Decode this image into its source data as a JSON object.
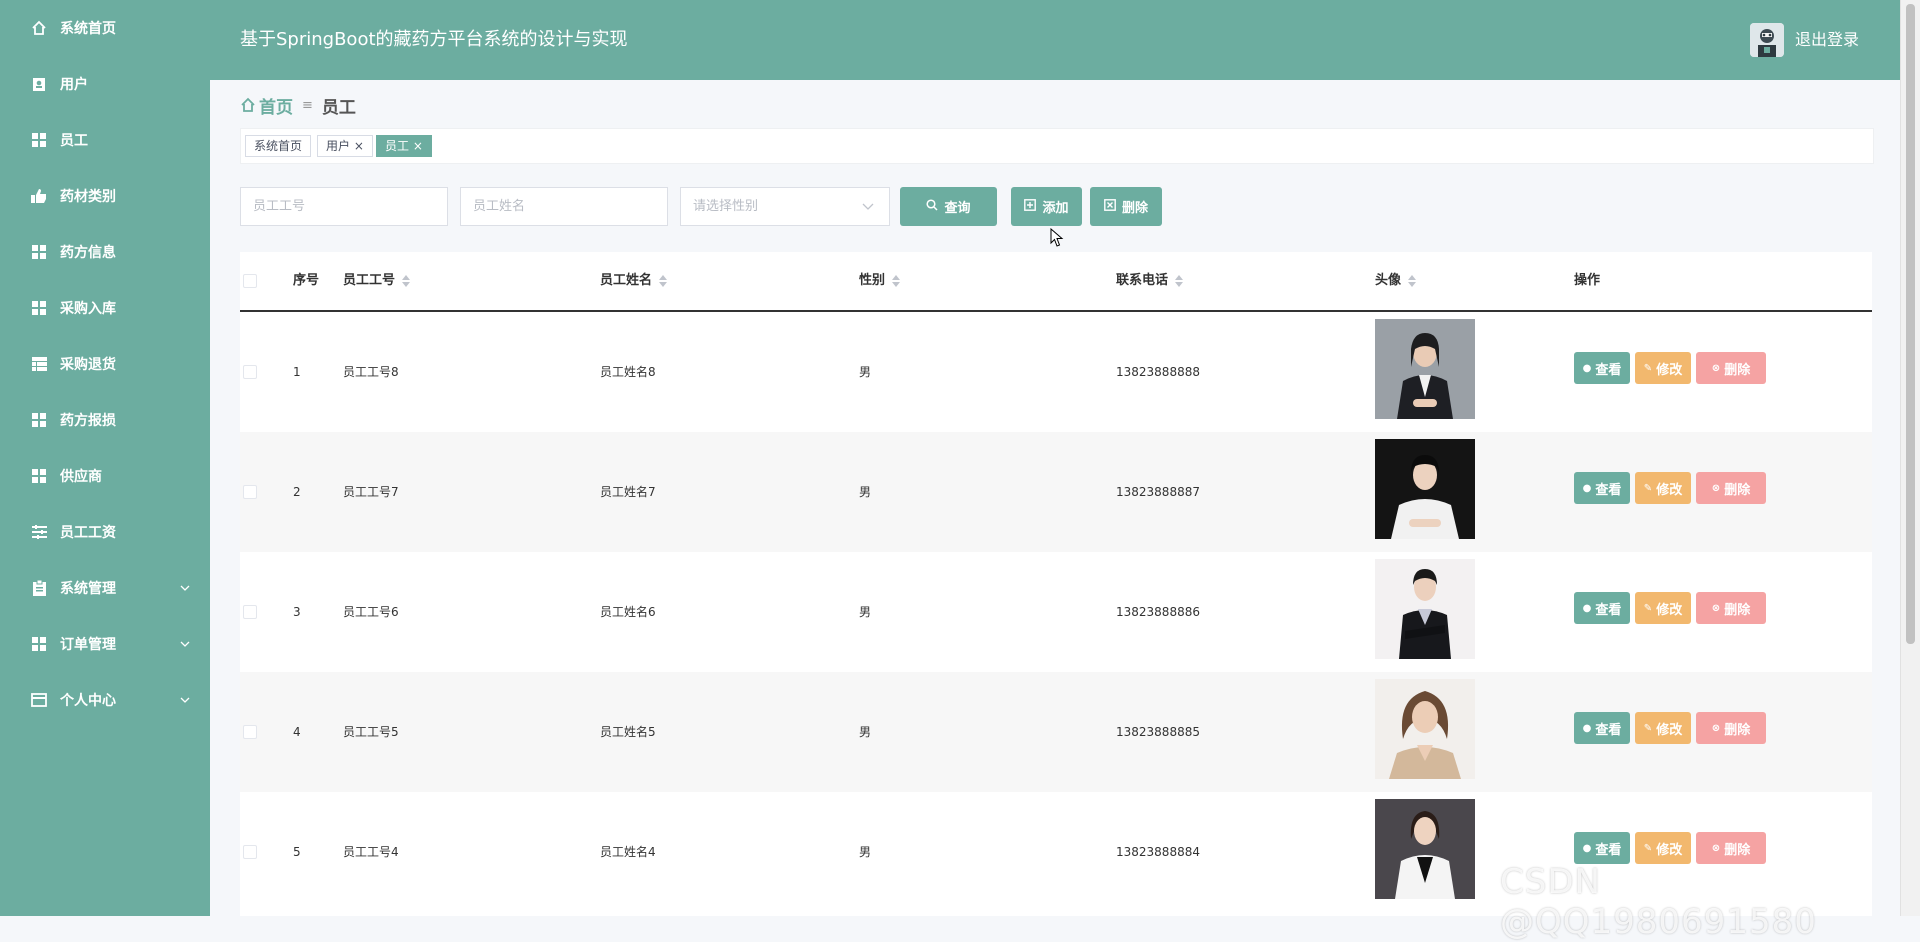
{
  "app": {
    "title": "基于SpringBoot的藏药方平台系统的设计与实现",
    "logout_label": "退出登录"
  },
  "sidebar": {
    "items": [
      {
        "label": "系统首页",
        "icon": "home-icon"
      },
      {
        "label": "用户",
        "icon": "user-icon"
      },
      {
        "label": "员工",
        "icon": "grid-icon"
      },
      {
        "label": "药材类别",
        "icon": "thumb-icon"
      },
      {
        "label": "药方信息",
        "icon": "grid-icon"
      },
      {
        "label": "采购入库",
        "icon": "grid-icon"
      },
      {
        "label": "采购退货",
        "icon": "table-icon"
      },
      {
        "label": "药方报损",
        "icon": "grid-icon"
      },
      {
        "label": "供应商",
        "icon": "grid-icon"
      },
      {
        "label": "员工工资",
        "icon": "sliders-icon"
      },
      {
        "label": "系统管理",
        "icon": "clipboard-icon",
        "has_submenu": true
      },
      {
        "label": "订单管理",
        "icon": "grid-icon",
        "has_submenu": true
      },
      {
        "label": "个人中心",
        "icon": "card-icon",
        "has_submenu": true
      }
    ]
  },
  "breadcrumb": {
    "home": "首页",
    "separator": "≡",
    "current": "员工"
  },
  "tags": [
    {
      "label": "系统首页",
      "closable": false,
      "active": false
    },
    {
      "label": "用户",
      "closable": true,
      "active": false
    },
    {
      "label": "员工",
      "closable": true,
      "active": true
    }
  ],
  "search": {
    "emp_no_placeholder": "员工工号",
    "emp_name_placeholder": "员工姓名",
    "gender_placeholder": "请选择性别",
    "query_label": "查询",
    "add_label": "添加",
    "delete_label": "删除"
  },
  "table": {
    "columns": [
      "序号",
      "员工工号",
      "员工姓名",
      "性别",
      "联系电话",
      "头像",
      "操作"
    ],
    "rows": [
      {
        "index": "1",
        "emp_no": "员工工号8",
        "name": "员工姓名8",
        "gender": "男",
        "phone": "13823888888"
      },
      {
        "index": "2",
        "emp_no": "员工工号7",
        "name": "员工姓名7",
        "gender": "男",
        "phone": "13823888887"
      },
      {
        "index": "3",
        "emp_no": "员工工号6",
        "name": "员工姓名6",
        "gender": "男",
        "phone": "13823888886"
      },
      {
        "index": "4",
        "emp_no": "员工工号5",
        "name": "员工姓名5",
        "gender": "男",
        "phone": "13823888885"
      },
      {
        "index": "5",
        "emp_no": "员工工号4",
        "name": "员工姓名4",
        "gender": "男",
        "phone": "13823888884"
      }
    ],
    "actions": {
      "view": "查看",
      "edit": "修改",
      "delete": "删除"
    }
  },
  "watermark": "CSDN @QQ1980691580",
  "colors": {
    "primary": "#6cada0",
    "edit": "#f2b86e",
    "delete": "#f5a3a3"
  }
}
